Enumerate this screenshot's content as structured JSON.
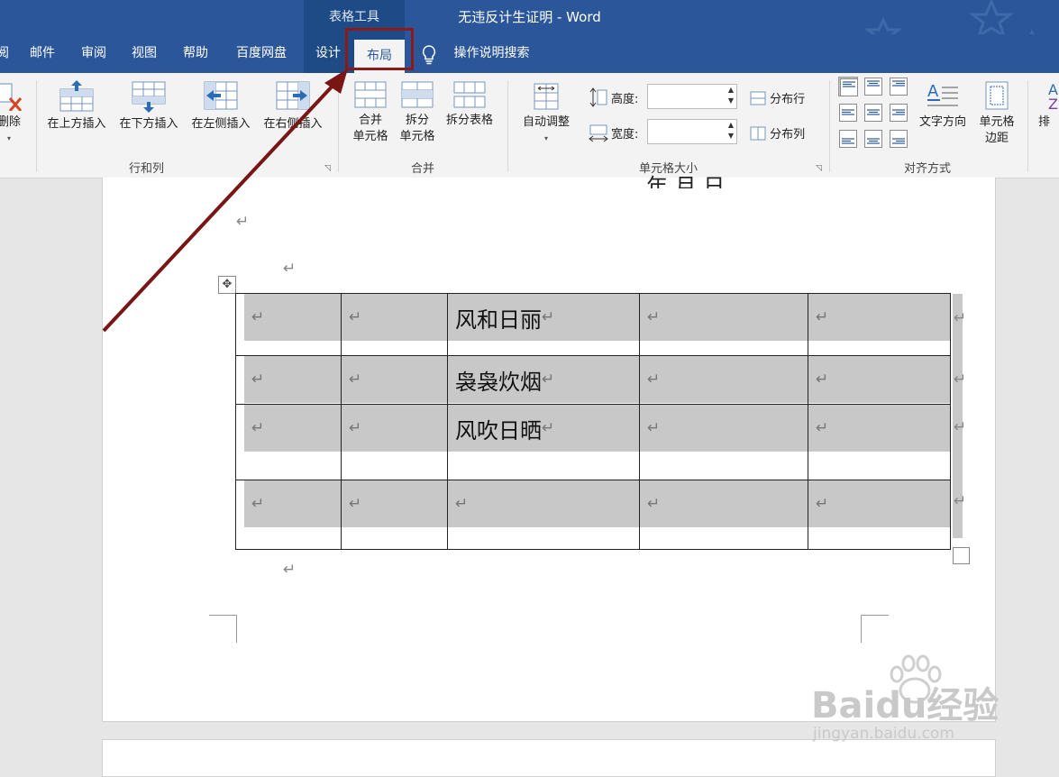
{
  "window": {
    "context_tools": "表格工具",
    "title": "无违反计生证明  -  Word"
  },
  "tabs": {
    "partial_left": "阅",
    "mail": "邮件",
    "review": "审阅",
    "view": "视图",
    "help": "帮助",
    "baidu": "百度网盘",
    "design": "设计",
    "layout": "布局",
    "tell_me": "操作说明搜索"
  },
  "ribbon": {
    "delete": "删除",
    "insert_above": "在上方插入",
    "insert_below": "在下方插入",
    "insert_left": "在左侧插入",
    "insert_right": "在右侧插入",
    "merge_cells_1": "合并",
    "merge_cells_2": "单元格",
    "split_cells_1": "拆分",
    "split_cells_2": "单元格",
    "split_table": "拆分表格",
    "autofit": "自动调整",
    "height_label": "高度:",
    "width_label": "宽度:",
    "distribute_rows": "分布行",
    "distribute_cols": "分布列",
    "text_direction": "文字方向",
    "cell_margins_1": "单元格",
    "cell_margins_2": "边距",
    "sort_partial": "排",
    "group_rows_cols": "行和列",
    "group_merge": "合并",
    "group_cell_size": "单元格大小",
    "group_alignment": "对齐方式"
  },
  "document": {
    "top_partial_text": "年      月      日",
    "para_mark": "↵",
    "table": {
      "rows": [
        [
          "↵",
          "↵",
          "风和日丽↵",
          "↵",
          "↵"
        ],
        [
          "↵",
          "↵",
          "袅袅炊烟↵",
          "↵",
          "↵"
        ],
        [
          "↵",
          "↵",
          "风吹日晒↵",
          "↵",
          "↵"
        ],
        [
          "↵",
          "↵",
          "↵",
          "↵",
          "↵"
        ]
      ]
    }
  },
  "watermark": {
    "brand": "Baidu经验",
    "url": "jingyan.baidu.com"
  },
  "colors": {
    "title_bar": "#2b579a",
    "context_band": "#1e4a86",
    "highlight_box": "#8b1a1a",
    "arrow": "#7a1515",
    "cell_shade": "#c8c8c8"
  }
}
